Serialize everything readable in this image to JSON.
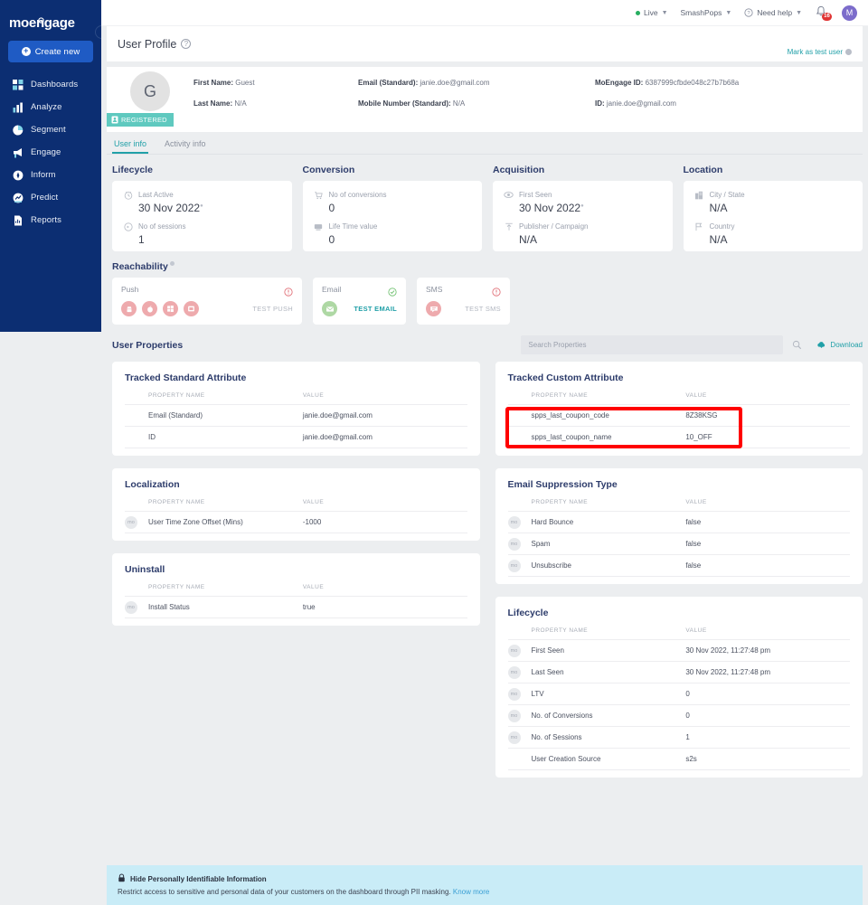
{
  "colors": {
    "sidebar_bg": "#0c2e72",
    "accent_teal": "#21a0a8",
    "brand_blue": "#1f5bc4",
    "highlight_red": "#ff0000",
    "badge_red": "#e03434",
    "registered_teal": "#5fc9bf",
    "pii_banner": "#c9ecf7"
  },
  "sidebar": {
    "logo": "moengage",
    "create_new": "Create new",
    "items": [
      {
        "label": "Dashboards",
        "icon": "dashboards-icon"
      },
      {
        "label": "Analyze",
        "icon": "analyze-icon"
      },
      {
        "label": "Segment",
        "icon": "segment-icon"
      },
      {
        "label": "Engage",
        "icon": "engage-icon"
      },
      {
        "label": "Inform",
        "icon": "inform-icon"
      },
      {
        "label": "Predict",
        "icon": "predict-icon"
      },
      {
        "label": "Reports",
        "icon": "reports-icon"
      }
    ]
  },
  "topbar": {
    "live": "Live",
    "workspace": "SmashPops",
    "help": "Need help",
    "notification_count": "16",
    "avatar_initial": "M"
  },
  "page": {
    "title": "User Profile",
    "mark_as_test_user": "Mark as test user"
  },
  "profile": {
    "avatar_initial": "G",
    "registered_badge": "REGISTERED",
    "fields": [
      {
        "label": "First Name:",
        "value": "Guest"
      },
      {
        "label": "Last Name:",
        "value": "N/A"
      },
      {
        "label": "Email (Standard):",
        "value": "janie.doe@gmail.com"
      },
      {
        "label": "Mobile Number (Standard):",
        "value": "N/A"
      },
      {
        "label": "MoEngage ID:",
        "value": "6387999cfbde048c27b7b68a"
      },
      {
        "label": "ID:",
        "value": "janie.doe@gmail.com"
      }
    ]
  },
  "tabs": [
    {
      "label": "User info",
      "active": true
    },
    {
      "label": "Activity info",
      "active": false
    }
  ],
  "stat_sections": [
    {
      "title": "Lifecycle",
      "rows": [
        {
          "icon": "clock-icon",
          "label": "Last Active",
          "value": "30 Nov 2022",
          "sup": true
        },
        {
          "icon": "sessions-icon",
          "label": "No of sessions",
          "value": "1",
          "sup": false
        }
      ]
    },
    {
      "title": "Conversion",
      "rows": [
        {
          "icon": "cart-icon",
          "label": "No of conversions",
          "value": "0",
          "sup": false
        },
        {
          "icon": "ltv-icon",
          "label": "Life Time value",
          "value": "0",
          "sup": false
        }
      ]
    },
    {
      "title": "Acquisition",
      "rows": [
        {
          "icon": "eye-icon",
          "label": "First Seen",
          "value": "30 Nov 2022",
          "sup": true
        },
        {
          "icon": "upload-icon",
          "label": "Publisher / Campaign",
          "value": "N/A",
          "sup": false
        }
      ]
    },
    {
      "title": "Location",
      "rows": [
        {
          "icon": "building-icon",
          "label": "City / State",
          "value": "N/A",
          "sup": false
        },
        {
          "icon": "flag-icon",
          "label": "Country",
          "value": "N/A",
          "sup": false
        }
      ]
    }
  ],
  "reachability": {
    "title": "Reachability",
    "channels": [
      {
        "name": "Push",
        "status": "warning",
        "action": "TEST PUSH",
        "action_enabled": false,
        "chips": [
          "android-icon",
          "apple-icon",
          "windows-icon",
          "web-icon"
        ],
        "chip_color": "red"
      },
      {
        "name": "Email",
        "status": "ok",
        "action": "TEST EMAIL",
        "action_enabled": true,
        "chips": [
          "envelope-icon"
        ],
        "chip_color": "green"
      },
      {
        "name": "SMS",
        "status": "warning",
        "action": "TEST SMS",
        "action_enabled": false,
        "chips": [
          "chat-icon"
        ],
        "chip_color": "red"
      }
    ]
  },
  "user_properties": {
    "title": "User Properties",
    "search_placeholder": "Search Properties",
    "search_value": "",
    "download_label": "Download",
    "column_headers": {
      "name": "PROPERTY NAME",
      "value": "VALUE"
    },
    "cards_left": [
      {
        "title": "Tracked Standard Attribute",
        "show_mo_badge": false,
        "highlight": false,
        "rows": [
          {
            "name": "Email (Standard)",
            "value": "janie.doe@gmail.com"
          },
          {
            "name": "ID",
            "value": "janie.doe@gmail.com"
          }
        ]
      },
      {
        "title": "Localization",
        "show_mo_badge": true,
        "highlight": false,
        "rows": [
          {
            "name": "User Time Zone Offset (Mins)",
            "value": "-1000"
          }
        ]
      },
      {
        "title": "Uninstall",
        "show_mo_badge": true,
        "highlight": false,
        "rows": [
          {
            "name": "Install Status",
            "value": "true"
          }
        ]
      }
    ],
    "cards_right": [
      {
        "title": "Tracked Custom Attribute",
        "show_mo_badge": false,
        "highlight": true,
        "rows": [
          {
            "name": "spps_last_coupon_code",
            "value": "8Z38KSG"
          },
          {
            "name": "spps_last_coupon_name",
            "value": "10_OFF"
          }
        ]
      },
      {
        "title": "Email Suppression Type",
        "show_mo_badge": true,
        "highlight": false,
        "rows": [
          {
            "name": "Hard Bounce",
            "value": "false"
          },
          {
            "name": "Spam",
            "value": "false"
          },
          {
            "name": "Unsubscribe",
            "value": "false"
          }
        ]
      },
      {
        "title": "Lifecycle",
        "show_mo_badge": true,
        "highlight": false,
        "rows": [
          {
            "name": "First Seen",
            "value": "30 Nov 2022, 11:27:48 pm",
            "badge": true
          },
          {
            "name": "Last Seen",
            "value": "30 Nov 2022, 11:27:48 pm",
            "badge": true
          },
          {
            "name": "LTV",
            "value": "0",
            "badge": true
          },
          {
            "name": "No. of Conversions",
            "value": "0",
            "badge": true
          },
          {
            "name": "No. of Sessions",
            "value": "1",
            "badge": true
          },
          {
            "name": "User Creation Source",
            "value": "s2s",
            "badge": false
          }
        ]
      }
    ]
  },
  "pii_banner": {
    "title": "Hide Personally Identifiable Information",
    "description": "Restrict access to sensitive and personal data of your customers on the dashboard through PII masking.",
    "link": "Know more"
  }
}
